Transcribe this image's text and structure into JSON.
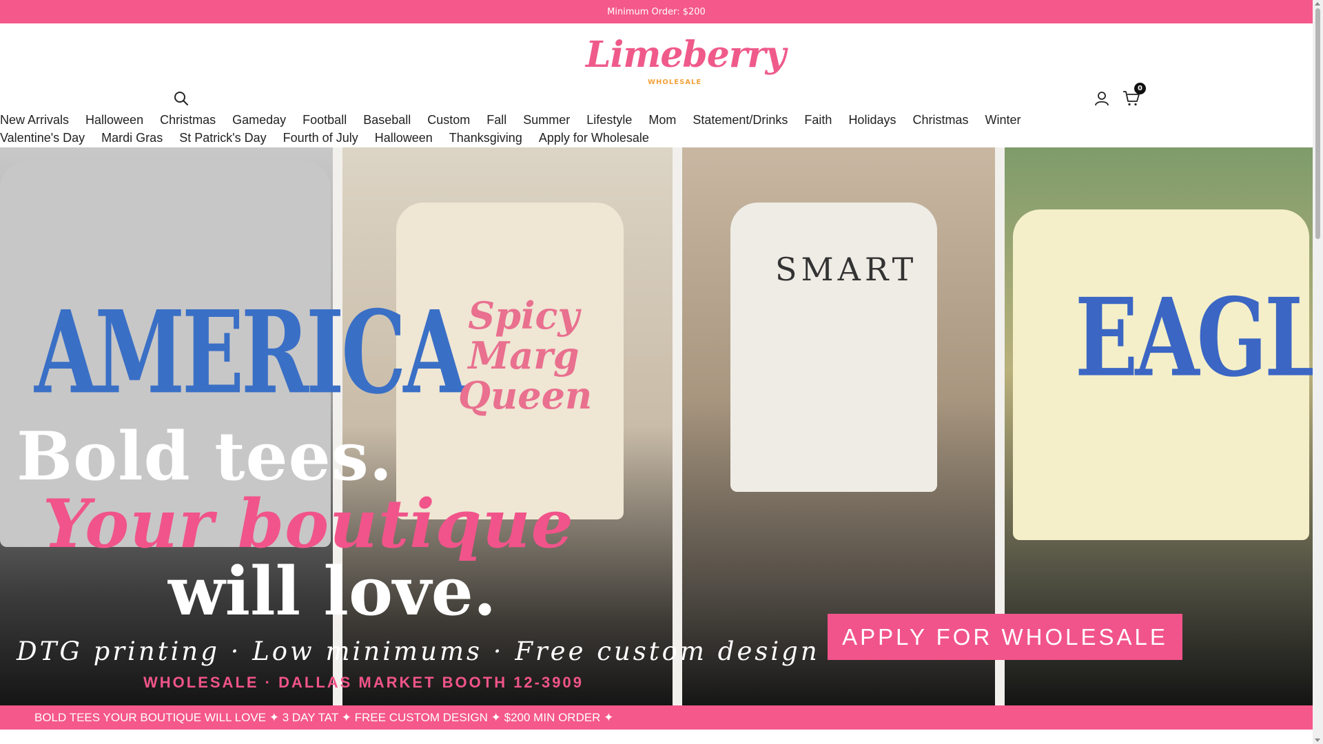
{
  "announcement": "Minimum Order: $200",
  "brand": {
    "logo_text": "Limeberry",
    "logo_sub": "WHOLESALE"
  },
  "header": {
    "cart_count": "0",
    "icons": [
      "search-icon",
      "account-icon",
      "cart-icon"
    ]
  },
  "nav": {
    "row1": [
      "New Arrivals",
      "Halloween",
      "Christmas",
      "Gameday",
      "Football",
      "Baseball",
      "Custom",
      "Fall",
      "Summer",
      "Lifestyle",
      "Mom",
      "Statement/Drinks",
      "Faith",
      "Holidays",
      "Christmas",
      "Winter"
    ],
    "row2": [
      "Valentine's Day",
      "Mardi Gras",
      "St Patrick's Day",
      "Fourth of July",
      "Halloween",
      "Thanksgiving",
      "Apply for Wholesale"
    ]
  },
  "hero": {
    "tee_texts": [
      "AMERICA",
      "Spicy Marg Queen",
      "SMART",
      "EAGLES"
    ],
    "headline_1": "Bold tees.",
    "headline_2": "Your boutique",
    "headline_3": "will love.",
    "tagline": "DTG printing · Low minimums · Free custom design",
    "booth": "WHOLESALE · DALLAS MARKET BOOTH 12-3909",
    "cta": "APPLY FOR WHOLESALE"
  },
  "marquee": "BOLD TEES YOUR BOUTIQUE WILL LOVE ✦ 3 DAY TAT ✦ FREE CUSTOM DESIGN ✦ $200 MIN ORDER ✦",
  "colors": {
    "brand_pink": "#f5588b",
    "accent_pink": "#f1548a",
    "logo_orange": "#f3a23c"
  }
}
